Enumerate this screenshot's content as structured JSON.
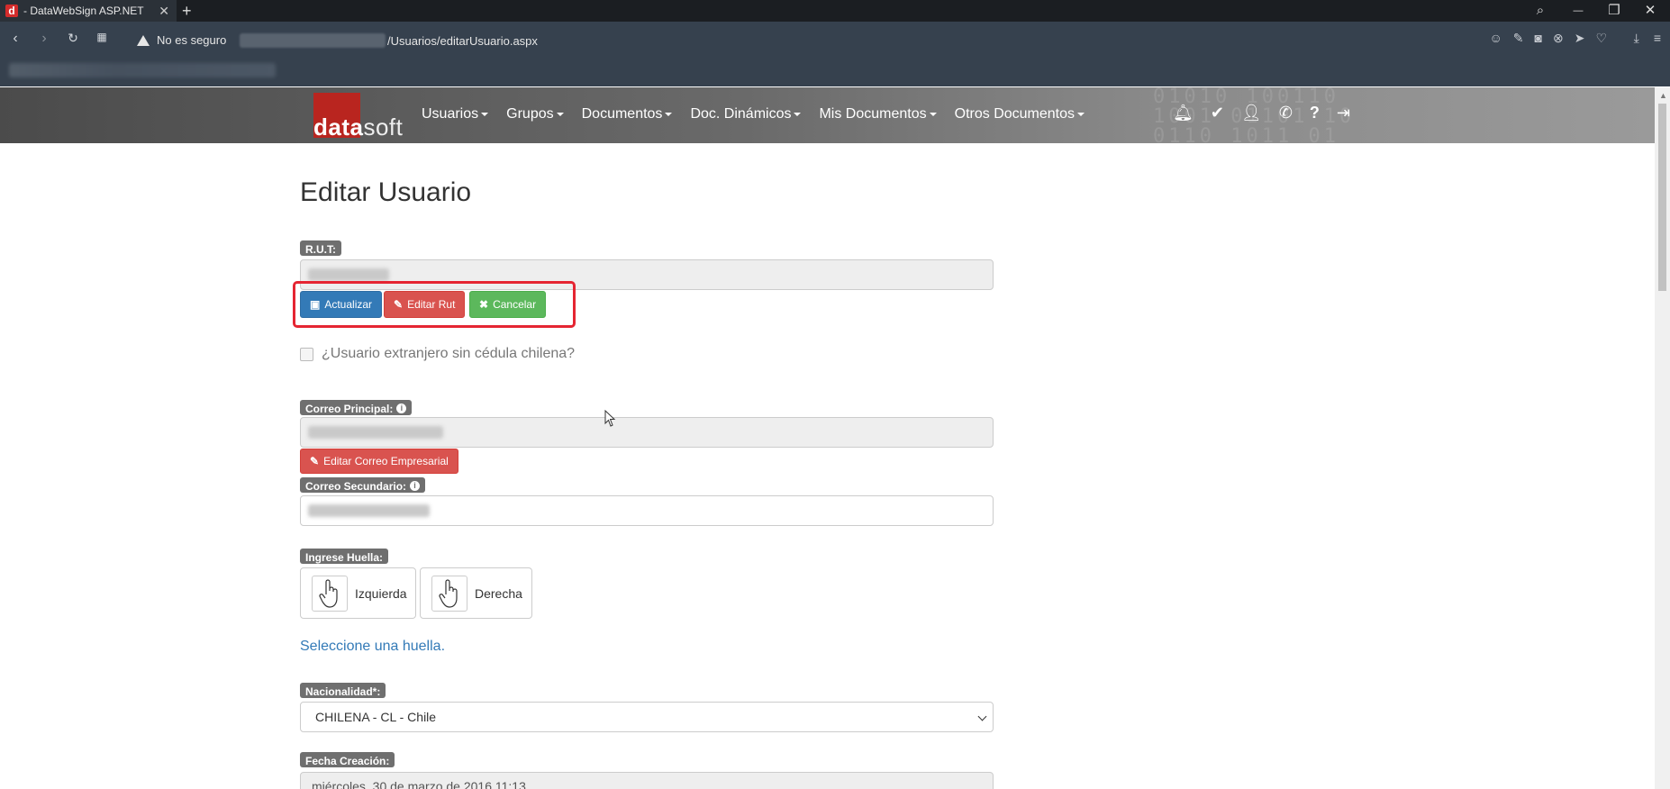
{
  "browser": {
    "tab_title": "- DataWebSign ASP.NET",
    "favicon_letter": "d",
    "tab_close": "✕",
    "new_tab": "+",
    "security_text": "No es seguro",
    "url_path": "/Usuarios/editarUsuario.aspx",
    "win_search": "⌕",
    "win_minimize": "—",
    "win_restore": "❐",
    "win_close": "✕"
  },
  "site": {
    "logo_data": "data",
    "logo_soft": "soft",
    "menu": [
      {
        "label": "Usuarios"
      },
      {
        "label": "Grupos"
      },
      {
        "label": "Documentos"
      },
      {
        "label": "Doc. Dinámicos"
      },
      {
        "label": "Mis Documentos"
      },
      {
        "label": "Otros Documentos"
      }
    ],
    "nav_icons": [
      "bell-icon",
      "check-icon",
      "user-icon",
      "phone-icon",
      "help-icon",
      "logout-icon"
    ]
  },
  "form": {
    "title": "Editar Usuario",
    "rut_label": "R.U.T:",
    "btn_update": "Actualizar",
    "btn_edit_rut": "Editar Rut",
    "btn_cancel": "Cancelar",
    "foreign_user_label": "¿Usuario extranjero sin cédula chilena?",
    "primary_email_label": "Correo Principal:",
    "btn_edit_email": "Editar Correo Empresarial",
    "secondary_email_label": "Correo Secundario:",
    "fingerprint_label": "Ingrese Huella:",
    "finger_left": "Izquierda",
    "finger_right": "Derecha",
    "select_fingerprint_text": "Seleccione una huella.",
    "nationality_label": "Nacionalidad*:",
    "nationality_value": "CHILENA - CL - Chile",
    "creation_date_label": "Fecha Creación:",
    "creation_date_value": "miércoles, 30 de marzo de 2016 11:13"
  },
  "colors": {
    "primary": "#337ab7",
    "danger": "#d9534f",
    "success": "#5cb85c",
    "highlight": "#e52532"
  }
}
